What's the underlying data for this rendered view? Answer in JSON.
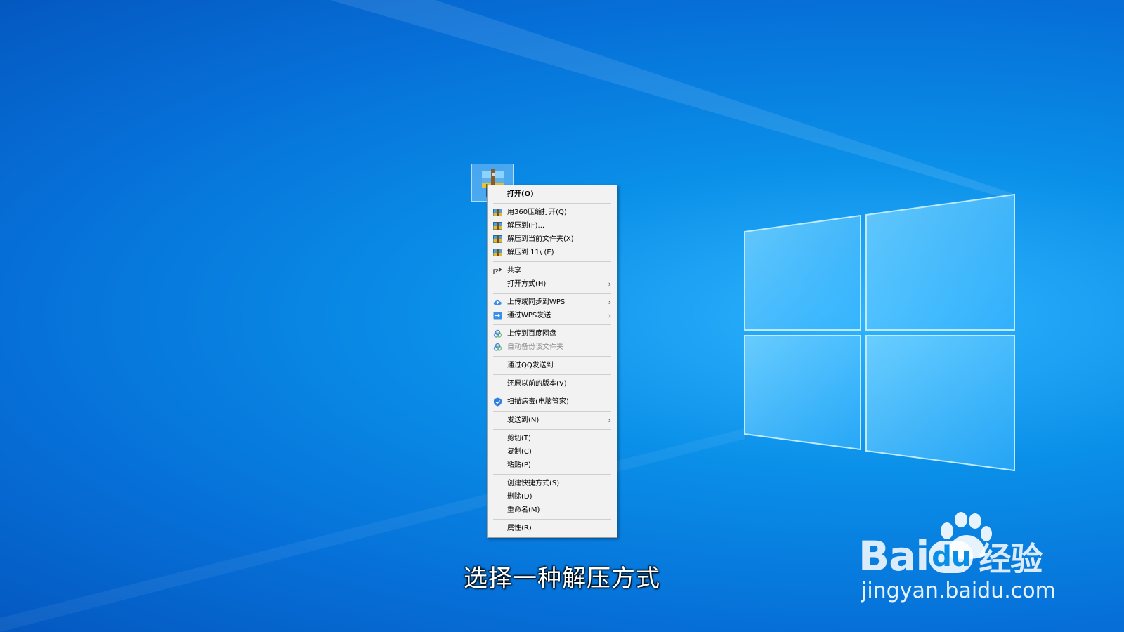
{
  "menu": {
    "items": [
      {
        "label": "打开(O)",
        "bold": true,
        "icon": ""
      },
      {
        "sep": true
      },
      {
        "label": "用360压缩打开(Q)",
        "icon": "archive-icon"
      },
      {
        "label": "解压到(F)...",
        "icon": "archive-icon"
      },
      {
        "label": "解压到当前文件夹(X)",
        "icon": "archive-icon"
      },
      {
        "label": "解压到 11\\ (E)",
        "icon": "archive-icon"
      },
      {
        "sep": true
      },
      {
        "label": "共享",
        "icon": "share-icon"
      },
      {
        "label": "打开方式(H)",
        "icon": "",
        "submenu": true
      },
      {
        "sep": true
      },
      {
        "label": "上传或同步到WPS",
        "icon": "cloud-upload-icon",
        "submenu": true
      },
      {
        "label": "通过WPS发送",
        "icon": "wps-send-icon",
        "submenu": true
      },
      {
        "sep": true
      },
      {
        "label": "上传到百度网盘",
        "icon": "baidu-netdisk-icon"
      },
      {
        "label": "自动备份该文件夹",
        "icon": "baidu-netdisk-icon",
        "disabled": true
      },
      {
        "sep": true
      },
      {
        "label": "通过QQ发送到",
        "icon": ""
      },
      {
        "sep": true
      },
      {
        "label": "还原以前的版本(V)",
        "icon": ""
      },
      {
        "sep": true
      },
      {
        "label": "扫描病毒(电脑管家)",
        "icon": "shield-icon"
      },
      {
        "sep": true
      },
      {
        "label": "发送到(N)",
        "icon": "",
        "submenu": true
      },
      {
        "sep": true
      },
      {
        "label": "剪切(T)",
        "icon": ""
      },
      {
        "label": "复制(C)",
        "icon": ""
      },
      {
        "label": "粘贴(P)",
        "icon": ""
      },
      {
        "sep": true
      },
      {
        "label": "创建快捷方式(S)",
        "icon": ""
      },
      {
        "label": "删除(D)",
        "icon": ""
      },
      {
        "label": "重命名(M)",
        "icon": ""
      },
      {
        "sep": true
      },
      {
        "label": "属性(R)",
        "icon": ""
      }
    ],
    "submenu_arrow": "›"
  },
  "desktop_icon": {
    "icon": "compressed-archive-icon",
    "selected": true
  },
  "caption": "选择一种解压方式",
  "watermark": {
    "logo_latin": "Bai",
    "logo_du": "du",
    "logo_cn": "经验",
    "url": "jingyan.baidu.com"
  },
  "colors": {
    "desktop": "#0a8fe8",
    "menu_bg": "#f2f2f2",
    "menu_border": "#a0a0a0",
    "selection": "#99d1ff"
  }
}
